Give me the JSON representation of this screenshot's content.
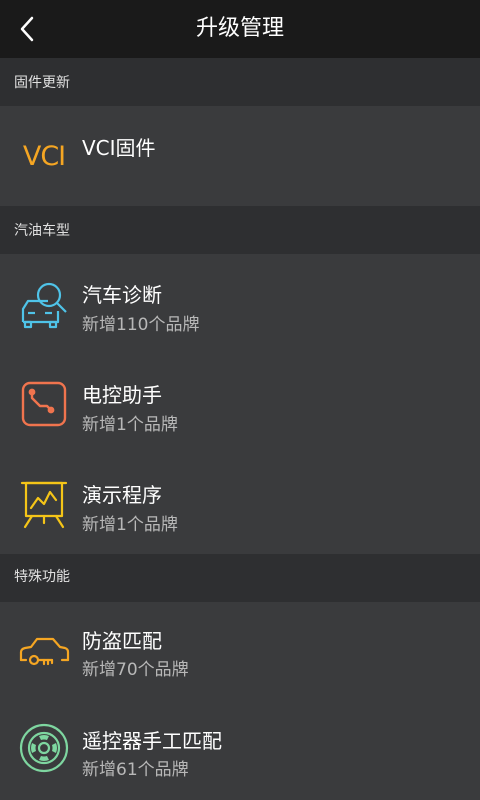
{
  "header": {
    "title": "升级管理",
    "back_icon": "back-arrow-icon"
  },
  "sections": [
    {
      "title": "固件更新",
      "items": [
        {
          "title": "VCI固件",
          "subtitle": "",
          "icon": "vci-text-icon",
          "icon_text": "VCI",
          "color": "#f5a623"
        }
      ]
    },
    {
      "title": "汽油车型",
      "items": [
        {
          "title": "汽车诊断",
          "subtitle": "新增110个品牌",
          "icon": "car-diagnosis-icon",
          "color": "#4fc3e8"
        },
        {
          "title": "电控助手",
          "subtitle": "新增1个品牌",
          "icon": "ecu-assistant-icon",
          "color": "#f0744e"
        },
        {
          "title": "演示程序",
          "subtitle": "新增1个品牌",
          "icon": "demo-board-icon",
          "color": "#f5c518"
        }
      ]
    },
    {
      "title": "特殊功能",
      "items": [
        {
          "title": "防盗匹配",
          "subtitle": "新增70个品牌",
          "icon": "car-key-icon",
          "color": "#f5a623"
        },
        {
          "title": "遥控器手工匹配",
          "subtitle": "新增61个品牌",
          "icon": "remote-control-icon",
          "color": "#7ed6a0"
        }
      ]
    }
  ],
  "colors": {
    "header_bg": "#1a1a1a",
    "section_bg": "#2e2f31",
    "row_bg": "#3a3b3d"
  }
}
